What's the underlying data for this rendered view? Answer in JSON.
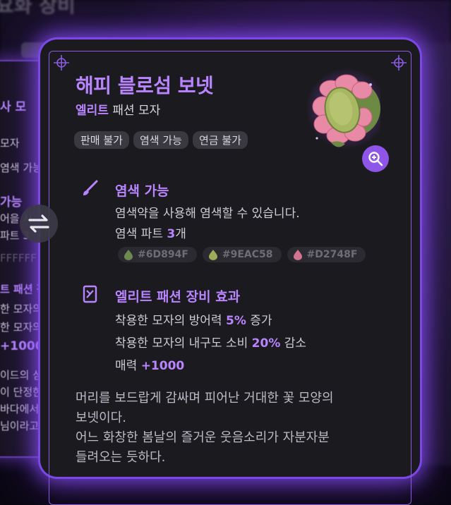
{
  "background": {
    "title_fragment": "요화 장비",
    "panel_lines": [
      "사 모",
      "모자",
      "염색 가능",
      "가능",
      "어을 사",
      "파트 3",
      "FFFFFF",
      "트 패션 장",
      "한 모자의",
      "한 모자의",
      "+1000",
      "이드의 심",
      "이 단정한",
      "바다에서",
      "님이라고"
    ]
  },
  "item": {
    "name": "해피 블로섬 보넷",
    "grade": "엘리트",
    "category": "패션 모자",
    "tags": [
      "판매 불가",
      "염색 가능",
      "연금 불가"
    ]
  },
  "dye": {
    "title": "염색 가능",
    "description": "염색약을 사용해 염색할 수 있습니다.",
    "parts_label": "염색 파트 ",
    "parts_count": "3",
    "parts_unit": "개",
    "colors": [
      {
        "code": "#6D894F",
        "hex": "#6D894F"
      },
      {
        "code": "#9EAC58",
        "hex": "#9EAC58"
      },
      {
        "code": "#D2748F",
        "hex": "#D2748F"
      }
    ]
  },
  "effect": {
    "title": "엘리트 패션 장비 효과",
    "line1_prefix": "착용한 모자의 방어력 ",
    "line1_value": "5%",
    "line1_suffix": " 증가",
    "line2_prefix": "착용한 모자의 내구도 소비 ",
    "line2_value": "20%",
    "line2_suffix": " 감소",
    "line3_prefix": "매력 ",
    "line3_value": "+1000"
  },
  "description": {
    "line1": "머리를 보드랍게 감싸며 피어난 거대한 꽃 모양의",
    "line2": "보넷이다.",
    "line3": "어느 화창한 봄날의 즐거운 웃음소리가 자분자분",
    "line4": "들려오는 듯하다."
  },
  "colors": {
    "accent": "#B985FF",
    "glow": "#7B47E6",
    "card_bg": "#1B1A1F"
  },
  "icons": [
    "swap-icon",
    "zoom-in-icon",
    "dye-brush-icon",
    "elite-card-icon",
    "corner-ornament-icon"
  ]
}
